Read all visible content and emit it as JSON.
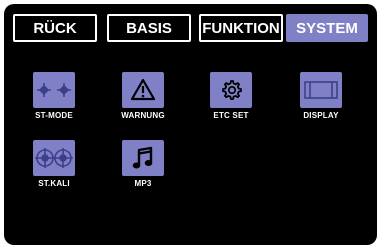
{
  "tabs": [
    {
      "label": "RÜCK",
      "active": false
    },
    {
      "label": "BASIS",
      "active": false
    },
    {
      "label": "FUNKTION",
      "active": false
    },
    {
      "label": "SYSTEM",
      "active": true
    }
  ],
  "apps": [
    {
      "label": "ST-MODE",
      "icon": "stick-mode-icon"
    },
    {
      "label": "WARNUNG",
      "icon": "warning-icon"
    },
    {
      "label": "ETC SET",
      "icon": "gear-icon"
    },
    {
      "label": "DISPLAY",
      "icon": "display-icon"
    },
    {
      "label": "ST.KALI",
      "icon": "stick-calibration-icon"
    },
    {
      "label": "MP3",
      "icon": "music-note-icon"
    }
  ],
  "colors": {
    "accent": "#7f80c6",
    "background": "#000000",
    "text": "#ffffff"
  }
}
